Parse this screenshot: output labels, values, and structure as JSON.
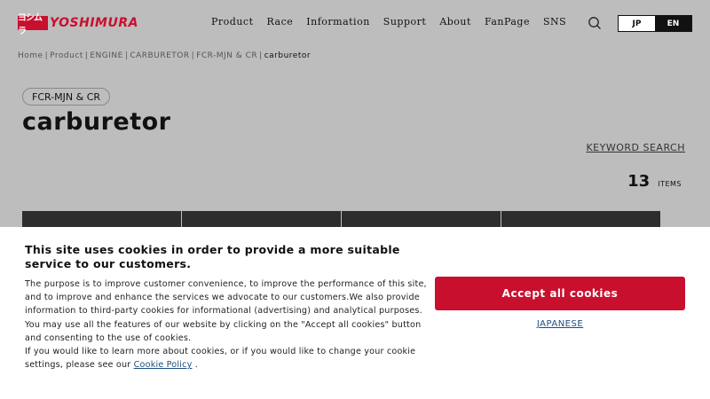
{
  "brand": {
    "mark": "ヨシムラ",
    "name": "YOSHIMURA",
    "color": "#c8102e"
  },
  "nav": {
    "items": [
      {
        "label": "Product"
      },
      {
        "label": "Race"
      },
      {
        "label": "Information"
      },
      {
        "label": "Support"
      },
      {
        "label": "About"
      },
      {
        "label": "FanPage"
      },
      {
        "label": "SNS"
      }
    ],
    "search_icon": "search-icon"
  },
  "language": {
    "jp": "JP",
    "en": "EN",
    "selected": "EN"
  },
  "breadcrumb": [
    {
      "label": "Home"
    },
    {
      "label": "Product"
    },
    {
      "label": "ENGINE"
    },
    {
      "label": "CARBURETOR"
    },
    {
      "label": "FCR-MJN & CR"
    },
    {
      "label": "carburetor"
    }
  ],
  "category": {
    "label": "FCR-MJN & CR"
  },
  "page": {
    "title": "carburetor",
    "keyword_search": "KEYWORD SEARCH",
    "items_count": "13",
    "items_label": "ITEMS"
  },
  "cookie": {
    "title": "This site uses cookies in order to provide a more suitable service to our customers.",
    "body": "The purpose is to improve customer convenience, to improve the performance of this site, and to improve and enhance the services we advocate to our customers.We also provide information to third-party cookies for informational (advertising) and analytical purposes. You may use all the features of our website by clicking on the \"Accept all cookies\" button and consenting to the use of cookies.",
    "body2_prefix": "If you would like to learn more about cookies, or if you would like to change your cookie settings, please see our",
    "policy_link": "Cookie Policy",
    "body2_suffix": " .",
    "accept_label": "Accept all cookies",
    "japanese_link": "JAPANESE",
    "accent_color": "#c8102e"
  }
}
